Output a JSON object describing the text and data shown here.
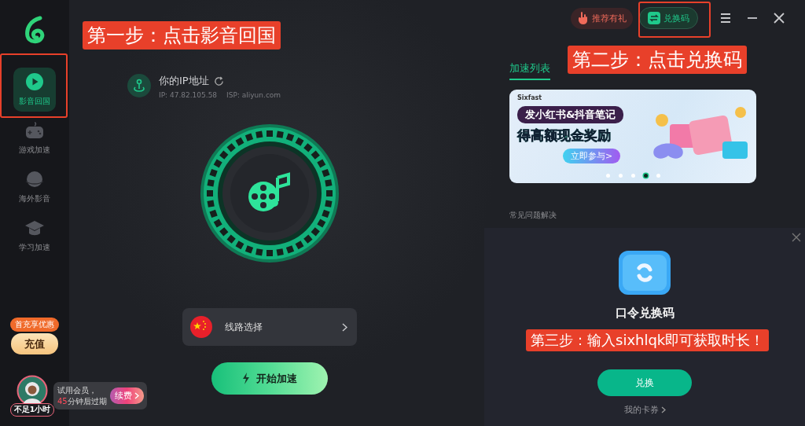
{
  "sidebar": {
    "nav_items": [
      {
        "label": "影音回国",
        "selected": true
      },
      {
        "label": "游戏加速",
        "selected": false
      },
      {
        "label": "海外影音",
        "selected": false
      },
      {
        "label": "学习加速",
        "selected": false
      }
    ],
    "promo_badge": "首充享优惠",
    "recharge_button": "充值",
    "member": {
      "time_left_badge": "不足1小时",
      "trial_line_1": "试用会员，",
      "trial_minutes": "45",
      "trial_line_2_rest": "分钟后过期",
      "renew_button": "续费"
    }
  },
  "top_bar": {
    "referral_button": "推荐有礼",
    "redeem_button": "兑换码"
  },
  "connection": {
    "title": "你的IP地址",
    "ip": "IP: 47.82.105.58",
    "isp": "ISP: aliyun.com",
    "route_label": "线路选择",
    "start_button": "开始加速"
  },
  "side_panel": {
    "tab": "加速列表",
    "banner": {
      "brand": "Sixfast",
      "headline": "发小红书&抖音笔记",
      "subline": "得高额现金奖励",
      "cta": "立即参与>",
      "dots": [
        {
          "selected": false
        },
        {
          "selected": false
        },
        {
          "selected": false
        },
        {
          "selected": true
        },
        {
          "selected": false
        }
      ]
    },
    "faq_link": "常见问题解决"
  },
  "redeem_dialog": {
    "title": "口令兑换码",
    "confirm_button": "兑换",
    "coupons_link": "我的卡券"
  },
  "annotations": [
    {
      "text": "第一步：点击影音回国"
    },
    {
      "text": "第二步：点击兑换码"
    },
    {
      "text": "第三步：输入sixhlqk即可获取时长！"
    }
  ]
}
